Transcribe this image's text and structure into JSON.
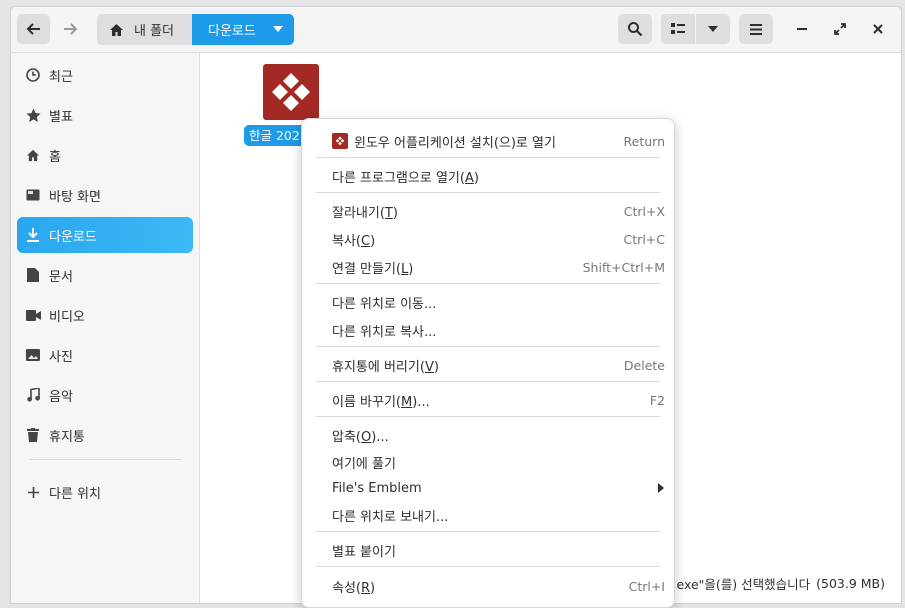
{
  "header": {
    "back_icon": "arrow-left-icon",
    "forward_icon": "arrow-right-icon",
    "breadcrumb": {
      "home_label": "내 폴더",
      "current_label": "다운로드"
    },
    "search_icon": "search-icon",
    "view_icon": "list-view-icon",
    "sort_icon": "chevron-down-icon",
    "menu_icon": "hamburger-icon",
    "minimize_icon": "minimize-icon",
    "maximize_icon": "maximize-icon",
    "close_icon": "close-icon"
  },
  "sidebar": {
    "items": [
      {
        "label": "최근",
        "icon": "clock-icon"
      },
      {
        "label": "별표",
        "icon": "star-icon"
      },
      {
        "label": "홈",
        "icon": "home-icon"
      },
      {
        "label": "바탕 화면",
        "icon": "desktop-icon"
      },
      {
        "label": "다운로드",
        "icon": "download-icon",
        "active": true
      },
      {
        "label": "문서",
        "icon": "document-icon"
      },
      {
        "label": "비디오",
        "icon": "video-icon"
      },
      {
        "label": "사진",
        "icon": "image-icon"
      },
      {
        "label": "음악",
        "icon": "music-icon"
      },
      {
        "label": "휴지통",
        "icon": "trash-icon"
      }
    ],
    "other_locations": "다른 위치"
  },
  "main": {
    "file_label": "한글 202",
    "status_text": "exe\"을(를) 선택했습니다",
    "status_size": "(503.9 MB)"
  },
  "context_menu": {
    "open_with_app": {
      "label": "윈도우 어플리케이션 설치(으)로 열기",
      "accel": "Return"
    },
    "open_other": {
      "pre": "다른 프로그램으로 열기(",
      "mn": "A",
      "post": ")"
    },
    "cut": {
      "pre": "잘라내기(",
      "mn": "T",
      "post": ")",
      "accel": "Ctrl+X"
    },
    "copy": {
      "pre": "복사(",
      "mn": "C",
      "post": ")",
      "accel": "Ctrl+C"
    },
    "link": {
      "pre": "연결 만들기(",
      "mn": "L",
      "post": ")",
      "accel": "Shift+Ctrl+M"
    },
    "move_to": "다른 위치로 이동...",
    "copy_to": "다른 위치로 복사...",
    "trash": {
      "pre": "휴지통에 버리기(",
      "mn": "V",
      "post": ")",
      "accel": "Delete"
    },
    "rename": {
      "pre": "이름 바꾸기(",
      "mn": "M",
      "post": ")...",
      "accel": "F2"
    },
    "compress": {
      "pre": "압축(",
      "mn": "O",
      "post": ")..."
    },
    "extract": "여기에 풀기",
    "emblem": "File's Emblem",
    "send_to": "다른 위치로 보내기...",
    "star": "별표 붙이기",
    "properties": {
      "pre": "속성(",
      "mn": "R",
      "post": ")",
      "accel": "Ctrl+I"
    }
  },
  "colors": {
    "accent": "#1e9be8",
    "app_red": "#a32a24"
  }
}
